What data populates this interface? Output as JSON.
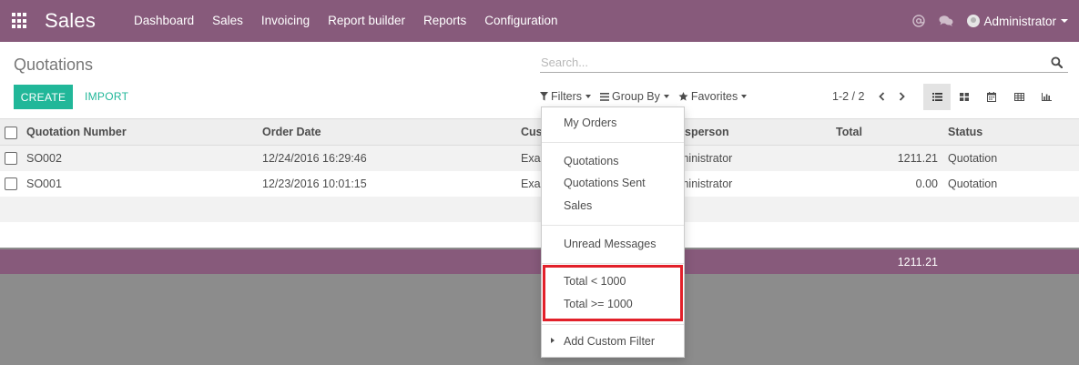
{
  "app": {
    "title": "Sales"
  },
  "menu": [
    "Dashboard",
    "Sales",
    "Invoicing",
    "Report builder",
    "Reports",
    "Configuration"
  ],
  "user": {
    "name": "Administrator"
  },
  "page": {
    "title": "Quotations"
  },
  "search": {
    "placeholder": "Search..."
  },
  "buttons": {
    "create": "CREATE",
    "import": "IMPORT"
  },
  "search_options": {
    "filters": "Filters",
    "group_by": "Group By",
    "favorites": "Favorites"
  },
  "pager": {
    "text": "1-2 / 2"
  },
  "table": {
    "headers": {
      "number": "Quotation Number",
      "order_date": "Order Date",
      "customer": "Cus",
      "salesperson": "sperson",
      "total": "Total",
      "status": "Status"
    },
    "rows": [
      {
        "number": "SO002",
        "order_date": "12/24/2016 16:29:46",
        "customer": "Exa",
        "salesperson": "ministrator",
        "total": "1211.21",
        "status": "Quotation"
      },
      {
        "number": "SO001",
        "order_date": "12/23/2016 10:01:15",
        "customer": "Exa",
        "salesperson": "ministrator",
        "total": "0.00",
        "status": "Quotation"
      }
    ],
    "footer_total": "1211.21"
  },
  "filters_menu": {
    "my_orders": "My Orders",
    "quotations": "Quotations",
    "quotations_sent": "Quotations Sent",
    "sales": "Sales",
    "unread_messages": "Unread Messages",
    "total_lt": "Total < 1000",
    "total_gte": "Total >= 1000",
    "add_custom": "Add Custom Filter"
  },
  "colors": {
    "navbar": "#875a7b",
    "primary_button": "#21b799",
    "highlight_box": "#e2202a"
  }
}
